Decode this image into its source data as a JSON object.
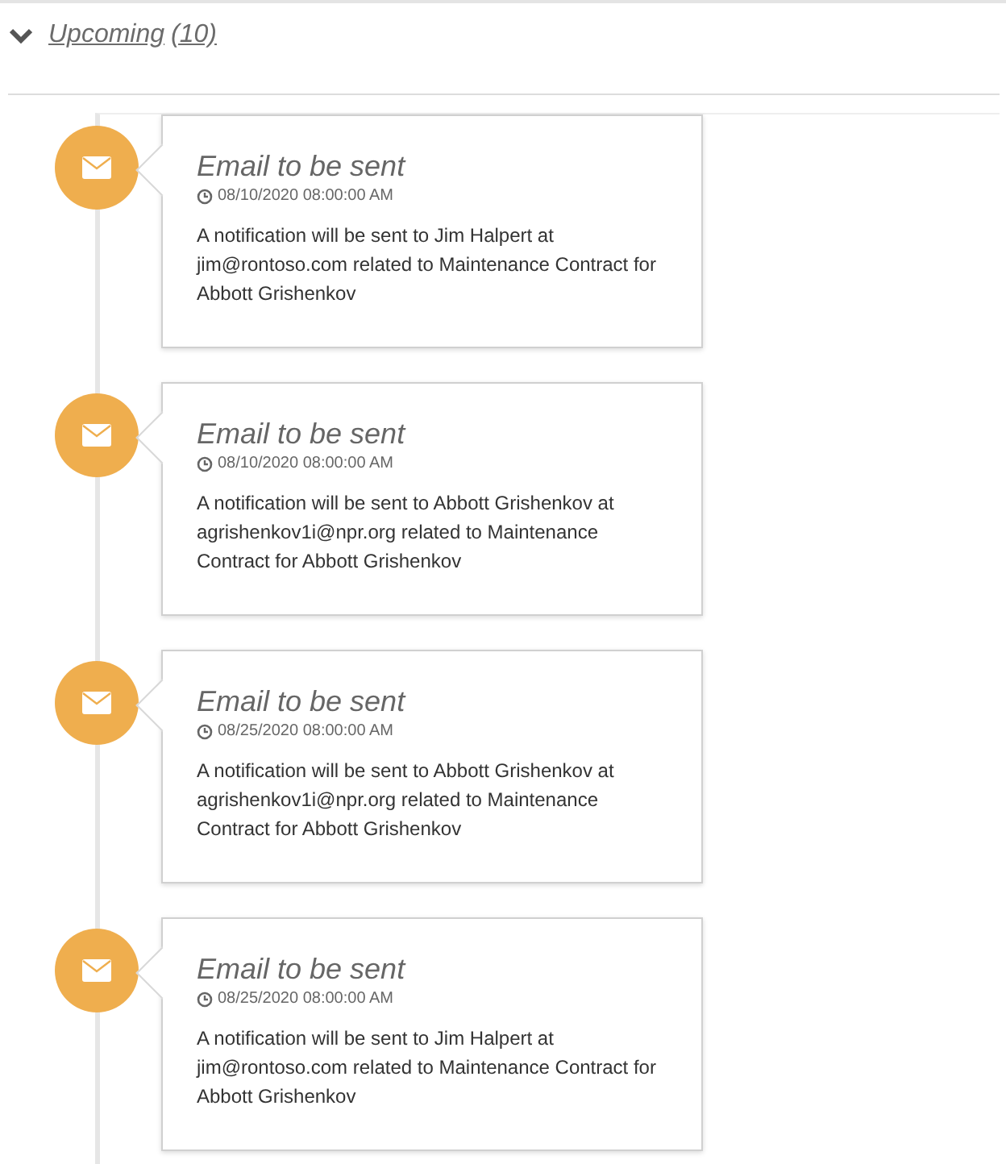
{
  "section": {
    "label": "Upcoming",
    "count": "(10)",
    "expanded": true
  },
  "events": [
    {
      "title": "Email to be sent",
      "time": "08/10/2020 08:00:00 AM",
      "body": "A notification will be sent to Jim Halpert at jim@rontoso.com related to Maintenance Contract for Abbott Grishenkov"
    },
    {
      "title": "Email to be sent",
      "time": "08/10/2020 08:00:00 AM",
      "body": "A notification will be sent to Abbott Grishenkov at agrishenkov1i@npr.org related to Maintenance Contract for Abbott Grishenkov"
    },
    {
      "title": "Email to be sent",
      "time": "08/25/2020 08:00:00 AM",
      "body": "A notification will be sent to Abbott Grishenkov at agrishenkov1i@npr.org related to Maintenance Contract for Abbott Grishenkov"
    },
    {
      "title": "Email to be sent",
      "time": "08/25/2020 08:00:00 AM",
      "body": "A notification will be sent to Jim Halpert at jim@rontoso.com related to Maintenance Contract for Abbott Grishenkov"
    }
  ]
}
